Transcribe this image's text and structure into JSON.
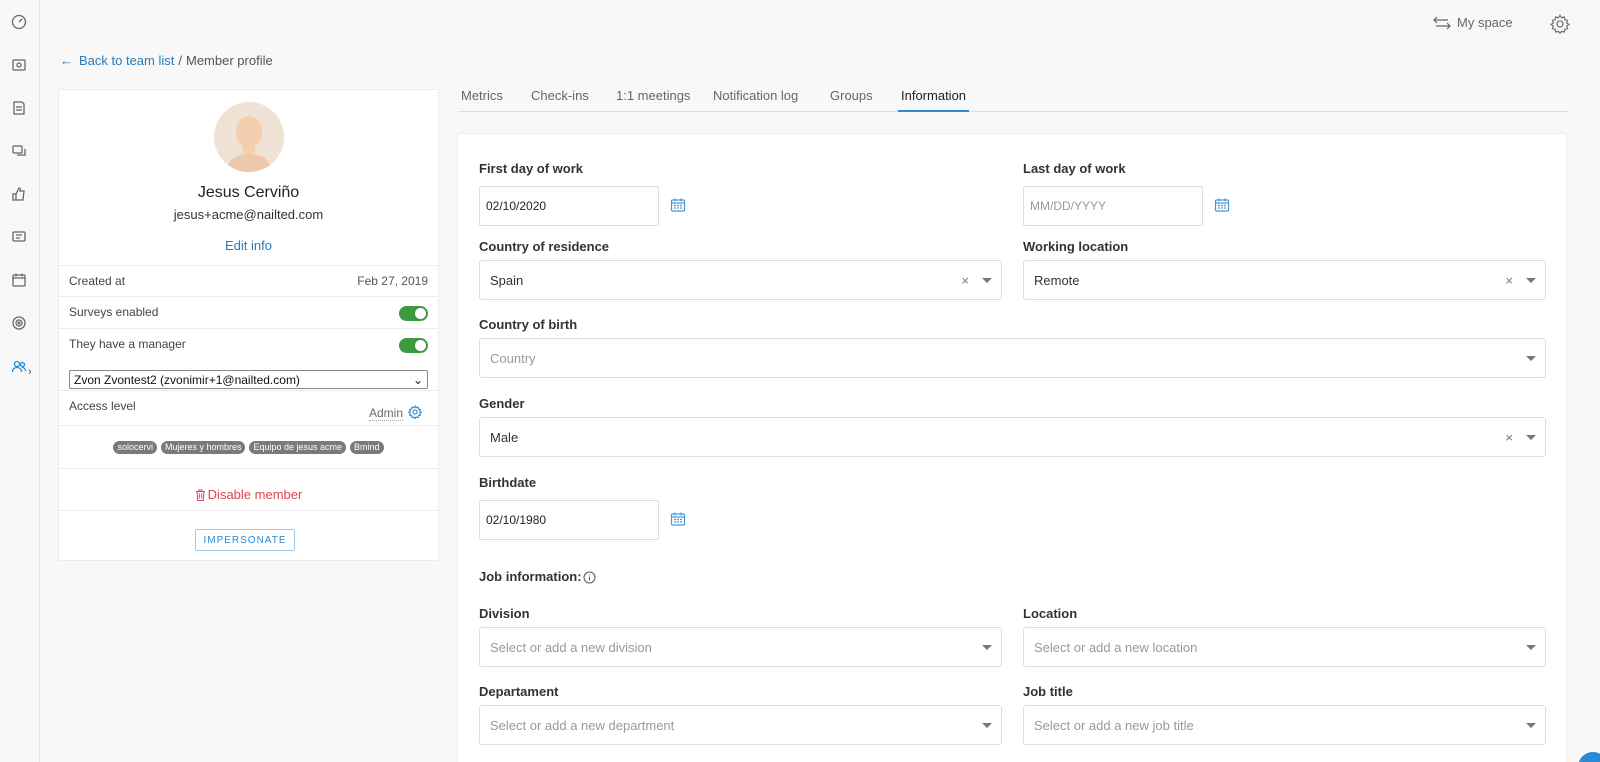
{
  "topbar": {
    "my_space": "My space"
  },
  "breadcrumb": {
    "back": "Back to team list",
    "sep": "/",
    "current": "Member profile"
  },
  "profile": {
    "name": "Jesus Cerviño",
    "email": "jesus+acme@nailted.com",
    "edit_info": "Edit info",
    "created_at_label": "Created at",
    "created_at_value": "Feb 27, 2019",
    "surveys_label": "Surveys enabled",
    "surveys_enabled": true,
    "manager_label": "They have a manager",
    "has_manager": true,
    "manager_select": "Zvon Zvontest2 (zvonimir+1@nailted.com)",
    "access_label": "Access level",
    "access_value": "Admin",
    "tags": [
      "solocervi",
      "Mujeres y hombres",
      "Equipo de jesus acme",
      "Bmind"
    ],
    "disable": "Disable member",
    "impersonate": "IMPERSONATE"
  },
  "tabs": [
    "Metrics",
    "Check-ins",
    "1:1 meetings",
    "Notification log",
    "Groups",
    "Information"
  ],
  "active_tab": "Information",
  "form": {
    "first_day_label": "First day of work",
    "first_day_value": "02/10/2020",
    "last_day_label": "Last day of work",
    "last_day_placeholder": "MM/DD/YYYY",
    "residence_label": "Country of residence",
    "residence_value": "Spain",
    "working_location_label": "Working location",
    "working_location_value": "Remote",
    "birth_country_label": "Country of birth",
    "birth_country_placeholder": "Country",
    "gender_label": "Gender",
    "gender_value": "Male",
    "birthdate_label": "Birthdate",
    "birthdate_value": "02/10/1980",
    "job_info_label": "Job information:",
    "division_label": "Division",
    "division_placeholder": "Select or add a new division",
    "location_label": "Location",
    "location_placeholder": "Select or add a new location",
    "department_label": "Departament",
    "department_placeholder": "Select or add a new department",
    "job_title_label": "Job title",
    "job_title_placeholder": "Select or add a new job title",
    "clear_glyph": "×"
  },
  "icons": {
    "rail": [
      "dashboard-icon",
      "surveys-icon",
      "reports-icon",
      "conversations-icon",
      "recognition-icon",
      "feedback-icon",
      "calendar-icon",
      "goals-icon",
      "team-icon"
    ],
    "accent": "#2a8ad4",
    "danger": "#e0434f",
    "toggle_on": "#3e9a3e"
  }
}
